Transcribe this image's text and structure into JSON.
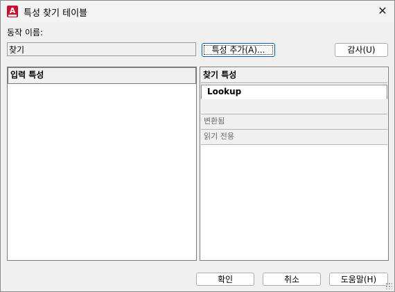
{
  "window": {
    "title": "특성 찾기 테이블",
    "app_icon_letter": "A",
    "close_glyph": "✕"
  },
  "action_name": {
    "label": "동작 이름:",
    "value": "찾기"
  },
  "buttons": {
    "add_property": "특성 추가(A)...",
    "audit": "감사(U)",
    "ok": "확인",
    "cancel": "취소",
    "help": "도움말(H)"
  },
  "input_properties": {
    "header": "입력 특성"
  },
  "lookup_properties": {
    "header": "찾기 특성",
    "rows": [
      "Lookup",
      "",
      "변환됨",
      "읽기 전용"
    ]
  }
}
